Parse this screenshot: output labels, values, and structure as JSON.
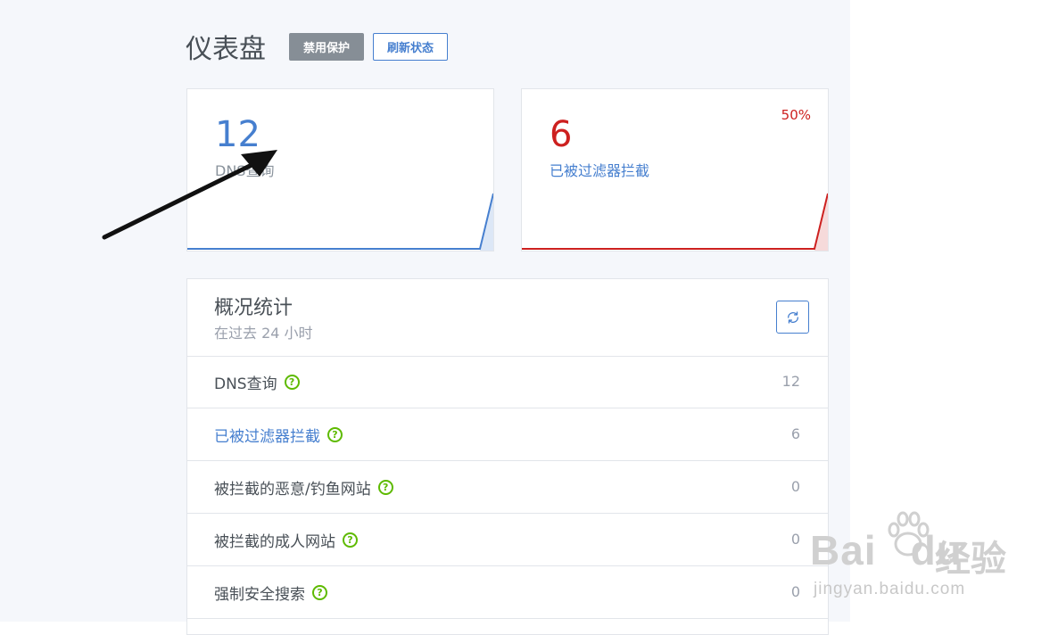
{
  "header": {
    "title": "仪表盘",
    "disable_protection_label": "禁用保护",
    "refresh_status_label": "刷新状态"
  },
  "stat_cards": [
    {
      "value": "12",
      "label": "DNS查询",
      "color": "#467fcf"
    },
    {
      "value": "6",
      "label": "已被过滤器拦截",
      "percent": "50%",
      "color": "#cd201f"
    }
  ],
  "overview": {
    "title": "概况统计",
    "subtitle": "在过去 24 小时",
    "rows": [
      {
        "label": "DNS查询",
        "value": "12"
      },
      {
        "label": "已被过滤器拦截",
        "value": "6"
      },
      {
        "label": "被拦截的恶意/钓鱼网站",
        "value": "0"
      },
      {
        "label": "被拦截的成人网站",
        "value": "0"
      },
      {
        "label": "强制安全搜索",
        "value": "0"
      }
    ]
  },
  "icons": {
    "help": "question-circle-icon",
    "refresh": "refresh-icon"
  },
  "watermark": {
    "brand": "Bai",
    "brand2": "du",
    "jingyan": "经验",
    "url": "jingyan.baidu.com"
  },
  "colors": {
    "primary": "#467fcf",
    "danger": "#cd201f",
    "secondary": "#868e96",
    "success": "#5eba00"
  }
}
